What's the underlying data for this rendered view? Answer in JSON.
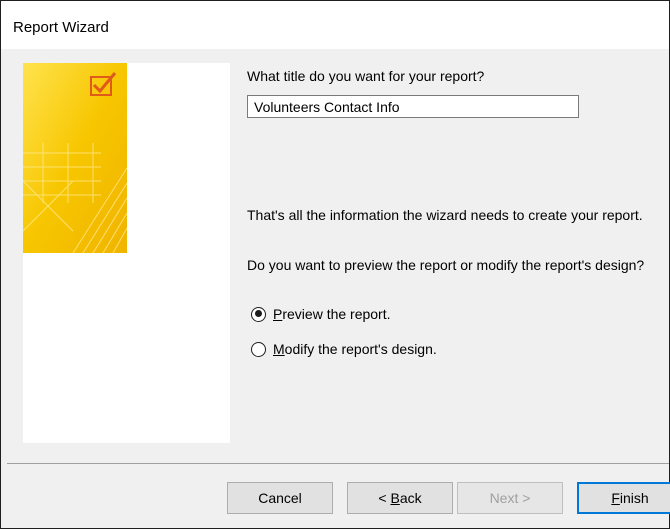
{
  "window": {
    "title": "Report Wizard"
  },
  "illustration": {
    "icon": "report-checkbox-icon",
    "accent": "#f5c518"
  },
  "title_prompt": "What title do you want for your report?",
  "title_value": "Volunteers Contact Info",
  "info_text": "That's all the information the wizard needs to create your report.",
  "preview_question": "Do you want to preview the report or modify the report's design?",
  "options": [
    {
      "mnemonic": "P",
      "rest": "review the report.",
      "selected": true
    },
    {
      "mnemonic": "M",
      "rest": "odify the report's design.",
      "selected": false
    }
  ],
  "buttons": {
    "cancel": "Cancel",
    "back_prefix": "< ",
    "back_mnemonic": "B",
    "back_rest": "ack",
    "next": "Next >",
    "finish_mnemonic": "F",
    "finish_rest": "inish"
  },
  "colors": {
    "focus_border": "#0078d7",
    "illustration_yellow": "#f7c600",
    "checkmark": "#e05a1a"
  }
}
